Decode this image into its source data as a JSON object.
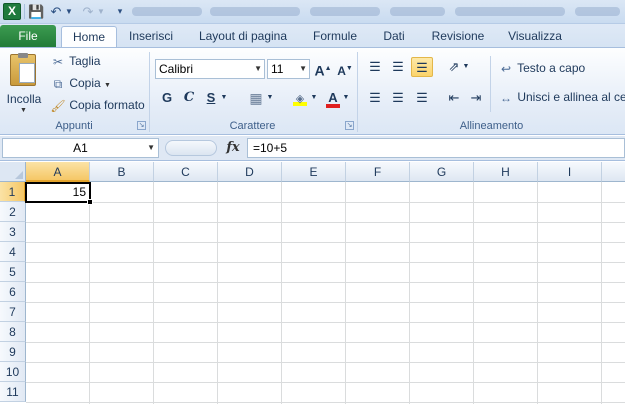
{
  "app": {
    "logo_letter": "X"
  },
  "tabs": {
    "file": "File",
    "items": [
      "Home",
      "Inserisci",
      "Layout di pagina",
      "Formule",
      "Dati",
      "Revisione",
      "Visualizza"
    ],
    "active": "Home"
  },
  "ribbon": {
    "clipboard": {
      "label": "Appunti",
      "paste": "Incolla",
      "cut": "Taglia",
      "copy": "Copia",
      "format_painter": "Copia formato"
    },
    "font": {
      "label": "Carattere",
      "font_name": "Calibri",
      "font_size": "11",
      "bold": "G",
      "italic": "C",
      "underline": "S"
    },
    "alignment": {
      "label": "Allineamento",
      "wrap_text": "Testo a capo",
      "merge_center": "Unisci e allinea al centro"
    }
  },
  "formula_bar": {
    "name_box": "A1",
    "fx": "fx",
    "formula": "=10+5"
  },
  "sheet": {
    "columns": [
      "A",
      "B",
      "C",
      "D",
      "E",
      "F",
      "G",
      "H",
      "I"
    ],
    "rows": [
      "1",
      "2",
      "3",
      "4",
      "5",
      "6",
      "7",
      "8",
      "9",
      "10",
      "11"
    ],
    "selected_column": "A",
    "selected_row": "1",
    "cells": {
      "A1": "15"
    }
  }
}
